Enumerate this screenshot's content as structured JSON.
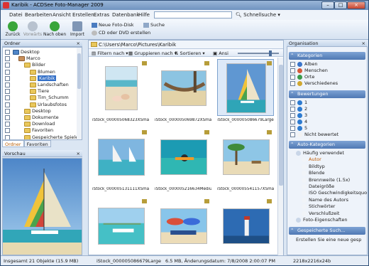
{
  "window": {
    "title": "Karibik - ACDSee Foto-Manager 2009"
  },
  "menu": [
    "Datei",
    "Bearbeiten",
    "Ansicht",
    "Erstellen",
    "Extras",
    "Datenbank",
    "Hilfe"
  ],
  "quick_search_label": "Schnellsuche",
  "toolbar": {
    "back": "Zurück",
    "forward": "Vorwärts",
    "up": "Nach oben",
    "import": "Import",
    "new_photo_disc": "Neue Foto-Disk",
    "search": "Suche",
    "cd_dvd": "CD oder DVD erstellen"
  },
  "folder_pane": {
    "title": "Ordner",
    "close": "×",
    "tree": [
      {
        "label": "Desktop",
        "kind": "desktop"
      },
      {
        "label": "Marco",
        "kind": "user"
      },
      {
        "label": "Bilder",
        "kind": "folder"
      },
      {
        "label": "Blumen",
        "kind": "folder"
      },
      {
        "label": "Karibik",
        "kind": "folder",
        "selected": true
      },
      {
        "label": "Landschaften",
        "kind": "folder"
      },
      {
        "label": "Tiere",
        "kind": "folder"
      },
      {
        "label": "Tim_Schumm",
        "kind": "folder"
      },
      {
        "label": "Urlaubsfotos",
        "kind": "folder"
      },
      {
        "label": "Desktop",
        "kind": "folder"
      },
      {
        "label": "Dokumente",
        "kind": "folder"
      },
      {
        "label": "Download",
        "kind": "folder"
      },
      {
        "label": "Favoriten",
        "kind": "folder"
      },
      {
        "label": "Gespeicherte Spiele",
        "kind": "folder"
      }
    ],
    "tabs": [
      "Ordner",
      "Favoriten"
    ]
  },
  "preview_pane": {
    "title": "Vorschau",
    "close": "×"
  },
  "browser": {
    "path": "C:\\Users\\Marco\\Pictures\\Karibik",
    "filter_label": "Filtern nach",
    "group_label": "Gruppieren nach",
    "sort_label": "Sortieren",
    "view_label": "Ansi",
    "thumbnails": [
      {
        "caption": "iStock_000005068323XSmall",
        "scene": "shells"
      },
      {
        "caption": "iStock_000005069872XSmall",
        "scene": "hammock"
      },
      {
        "caption": "iStock_000005086679Large",
        "scene": "sailboat",
        "selected": true
      },
      {
        "caption": "iStock_000005131111XSmall",
        "scene": "windsurf"
      },
      {
        "caption": "iStock_000005216634Medium",
        "scene": "snorkel"
      },
      {
        "caption": "iStock_000005541157XSmall",
        "scene": "palms"
      },
      {
        "caption": "iStock_000005650074XSmall",
        "scene": "boat"
      },
      {
        "caption": "iStock_000005674395XSmall",
        "scene": "umbrellas"
      },
      {
        "caption": "iStock_000005678653XSmall",
        "scene": "lighthouse"
      }
    ]
  },
  "organise_pane": {
    "title": "Organisation",
    "close": "×",
    "categories_title": "Kategorien",
    "categories": [
      "Alben",
      "Menschen",
      "Orte",
      "Verschiedenes"
    ],
    "ratings_title": "Bewertungen",
    "ratings": [
      "1",
      "2",
      "3",
      "4",
      "5",
      "Nicht bewertet"
    ],
    "auto_title": "Auto-Kategorien",
    "auto_items": [
      {
        "label": "Häufig verwendet",
        "indent": 1
      },
      {
        "label": "Autor",
        "indent": 2,
        "highlight": true
      },
      {
        "label": "Bildtyp",
        "indent": 2
      },
      {
        "label": "Blende",
        "indent": 2
      },
      {
        "label": "Brennweite (1.5x)",
        "indent": 2
      },
      {
        "label": "Dateigröße",
        "indent": 2
      },
      {
        "label": "ISO Geschwindigkeitsquote",
        "indent": 2
      },
      {
        "label": "Name des Autors",
        "indent": 2
      },
      {
        "label": "Stichwörter",
        "indent": 2
      },
      {
        "label": "Verschlußzeit",
        "indent": 2
      },
      {
        "label": "Foto-Eigenschaften",
        "indent": 1
      }
    ],
    "saved_title": "Gespeicherte Such...",
    "saved_item": "Erstellen Sie eine neue gesp"
  },
  "status": {
    "total": "Insgesamt 21 Objekte  (15.9 MB)",
    "file": "iStock_000005086679Large",
    "info": "6.5 MB, Änderungsdatum: 7/8/2008 2:00:07 PM",
    "dims": "2218x2216x24b"
  },
  "colors": {
    "accent": "#3470c7",
    "section": "#4f78b3",
    "highlight": "#c05a00"
  }
}
